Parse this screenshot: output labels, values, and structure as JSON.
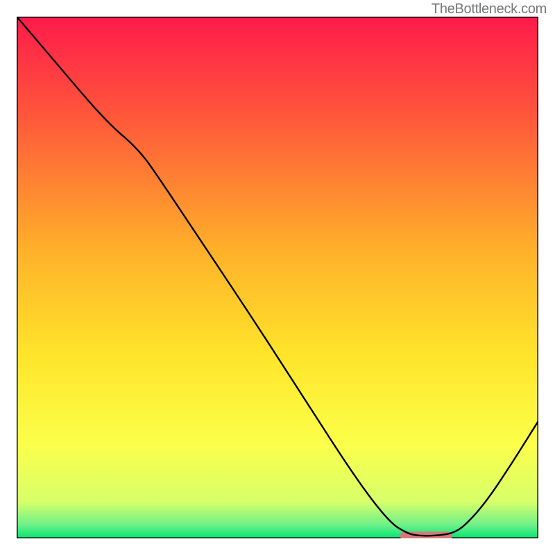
{
  "watermark": "TheBottleneck.com",
  "chart_data": {
    "type": "line",
    "title": "",
    "xlabel": "",
    "ylabel": "",
    "xlim": [
      0,
      100
    ],
    "ylim": [
      0,
      100
    ],
    "gradient_stops": [
      {
        "offset": 0.0,
        "color": "#ff1a4b"
      },
      {
        "offset": 0.2,
        "color": "#ff5a3a"
      },
      {
        "offset": 0.45,
        "color": "#ffb12a"
      },
      {
        "offset": 0.65,
        "color": "#ffe52a"
      },
      {
        "offset": 0.82,
        "color": "#fbff4a"
      },
      {
        "offset": 0.93,
        "color": "#d7ff6a"
      },
      {
        "offset": 0.975,
        "color": "#6cf08a"
      },
      {
        "offset": 1.0,
        "color": "#00e673"
      }
    ],
    "series": [
      {
        "name": "curve",
        "x": [
          0.0,
          6.0,
          17.0,
          23.5,
          28.0,
          34.0,
          45.0,
          55.0,
          65.0,
          71.5,
          75.0,
          77.0,
          80.0,
          83.5,
          86.0,
          90.0,
          95.0,
          100.0
        ],
        "y": [
          100.0,
          93.0,
          80.0,
          74.5,
          68.0,
          59.0,
          42.5,
          27.0,
          11.5,
          3.0,
          0.9,
          0.5,
          0.5,
          0.9,
          2.5,
          7.0,
          14.5,
          22.5
        ]
      }
    ],
    "marker": {
      "x_center": 78.5,
      "y_center": 0.5,
      "width": 10.0,
      "height": 1.6,
      "color": "#d47a7a"
    },
    "border_width": 3,
    "border_color": "#000000"
  }
}
